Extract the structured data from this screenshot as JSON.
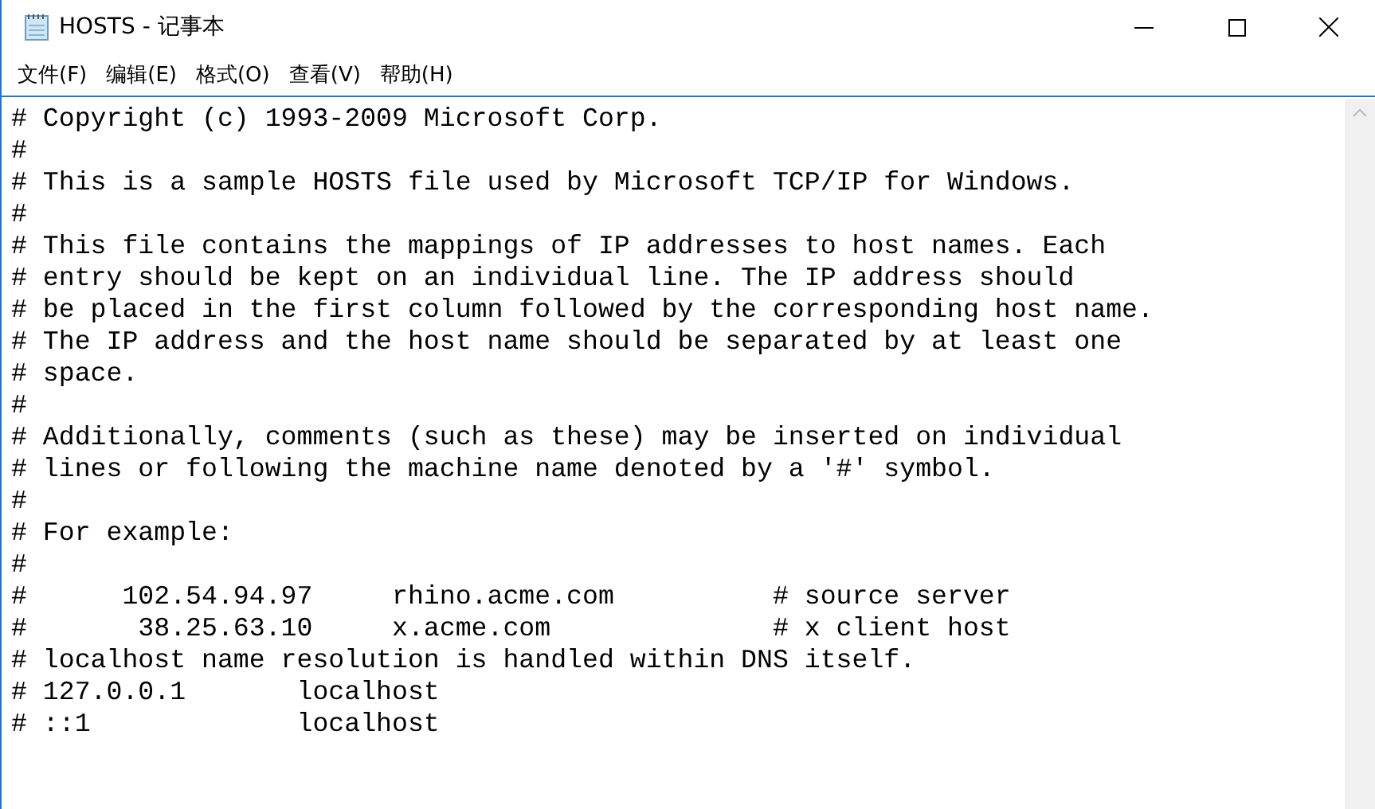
{
  "window": {
    "title": "HOSTS - 记事本"
  },
  "menu": [
    "文件(F)",
    "编辑(E)",
    "格式(O)",
    "查看(V)",
    "帮助(H)"
  ],
  "editor": {
    "lines": [
      "# Copyright (c) 1993-2009 Microsoft Corp.",
      "#",
      "# This is a sample HOSTS file used by Microsoft TCP/IP for Windows.",
      "#",
      "# This file contains the mappings of IP addresses to host names. Each",
      "# entry should be kept on an individual line. The IP address should",
      "# be placed in the first column followed by the corresponding host name.",
      "# The IP address and the host name should be separated by at least one",
      "# space.",
      "#",
      "# Additionally, comments (such as these) may be inserted on individual",
      "# lines or following the machine name denoted by a '#' symbol.",
      "#",
      "# For example:",
      "#",
      "#      102.54.94.97     rhino.acme.com          # source server",
      "#       38.25.63.10     x.acme.com              # x client host",
      "# localhost name resolution is handled within DNS itself.",
      "# 127.0.0.1       localhost",
      "# ::1             localhost"
    ]
  }
}
